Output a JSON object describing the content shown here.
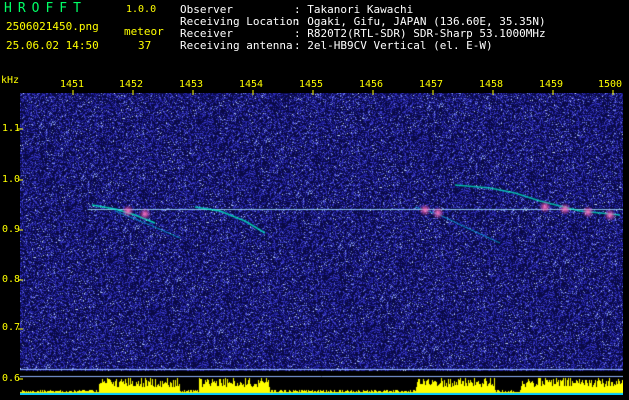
{
  "header": {
    "brand": "HROFFT",
    "version": "1.0.0",
    "filename": "2506021450.png",
    "datetime": "25.06.02 14:50",
    "meteor_label": "meteor",
    "meteor_count": "37",
    "info": [
      {
        "label": "Observer",
        "value": ": Takanori Kawachi"
      },
      {
        "label": "Receiving Location",
        "value": ": Ogaki, Gifu, JAPAN (136.60E, 35.35N)"
      },
      {
        "label": "Receiver",
        "value": ": R820T2(RTL-SDR) SDR-Sharp 53.1000MHz"
      },
      {
        "label": "Receiving antenna",
        "value": ": 2el-HB9CV Vertical (el. E-W)"
      }
    ]
  },
  "axes": {
    "y_unit": "kHz",
    "y_ticks": [
      "1.1",
      "1.0",
      "0.9",
      "0.8",
      "0.7",
      "0.6"
    ],
    "x_ticks": [
      "1451",
      "1452",
      "1453",
      "1454",
      "1455",
      "1456",
      "1457",
      "1458",
      "1459",
      "1500"
    ]
  },
  "colors": {
    "background": "#000000",
    "noise": "#1a1a8c",
    "signal": "#00ffcc",
    "hotspot": "#ff4fa0",
    "text": "#ffff00",
    "carrier": "#a0e0ff",
    "level_bars": "#ffff00"
  }
}
